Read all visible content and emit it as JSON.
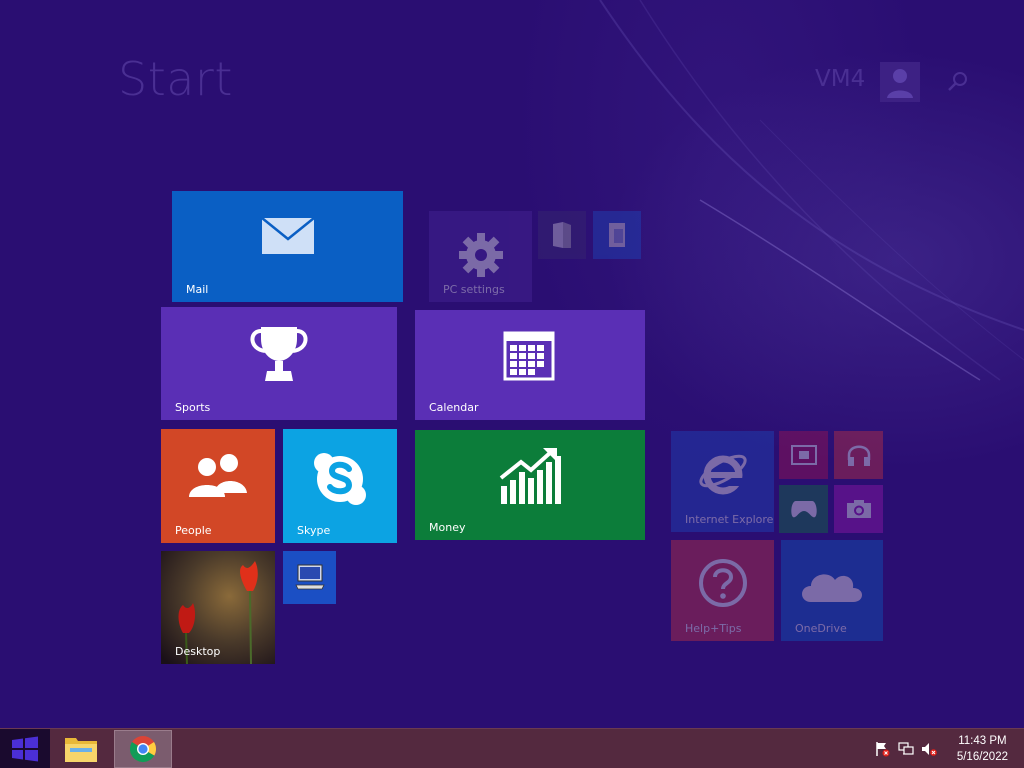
{
  "start": {
    "title": "Start"
  },
  "user": {
    "name": "VM4"
  },
  "tiles": {
    "mail": "Mail",
    "pc_settings": "PC settings",
    "sports": "Sports",
    "calendar": "Calendar",
    "people": "People",
    "skype": "Skype",
    "money": "Money",
    "desktop": "Desktop",
    "internet_explorer": "Internet Explorer",
    "help_tips": "Help+Tips",
    "onedrive": "OneDrive"
  },
  "colors": {
    "background": "#2a0e72",
    "mail": "#0a5fc4",
    "sports": "#5a2fb5",
    "calendar": "#5a2fb5",
    "people": "#d24726",
    "skype": "#0ca3e3",
    "money": "#0c7d3a",
    "taskbar": "#54293f"
  },
  "taskbar": {
    "apps": [
      "file-explorer-icon",
      "chrome-icon"
    ],
    "tray": [
      "action-center-flag-icon",
      "network-icon",
      "volume-muted-icon"
    ]
  },
  "clock": {
    "time": "11:43 PM",
    "date": "5/16/2022"
  }
}
